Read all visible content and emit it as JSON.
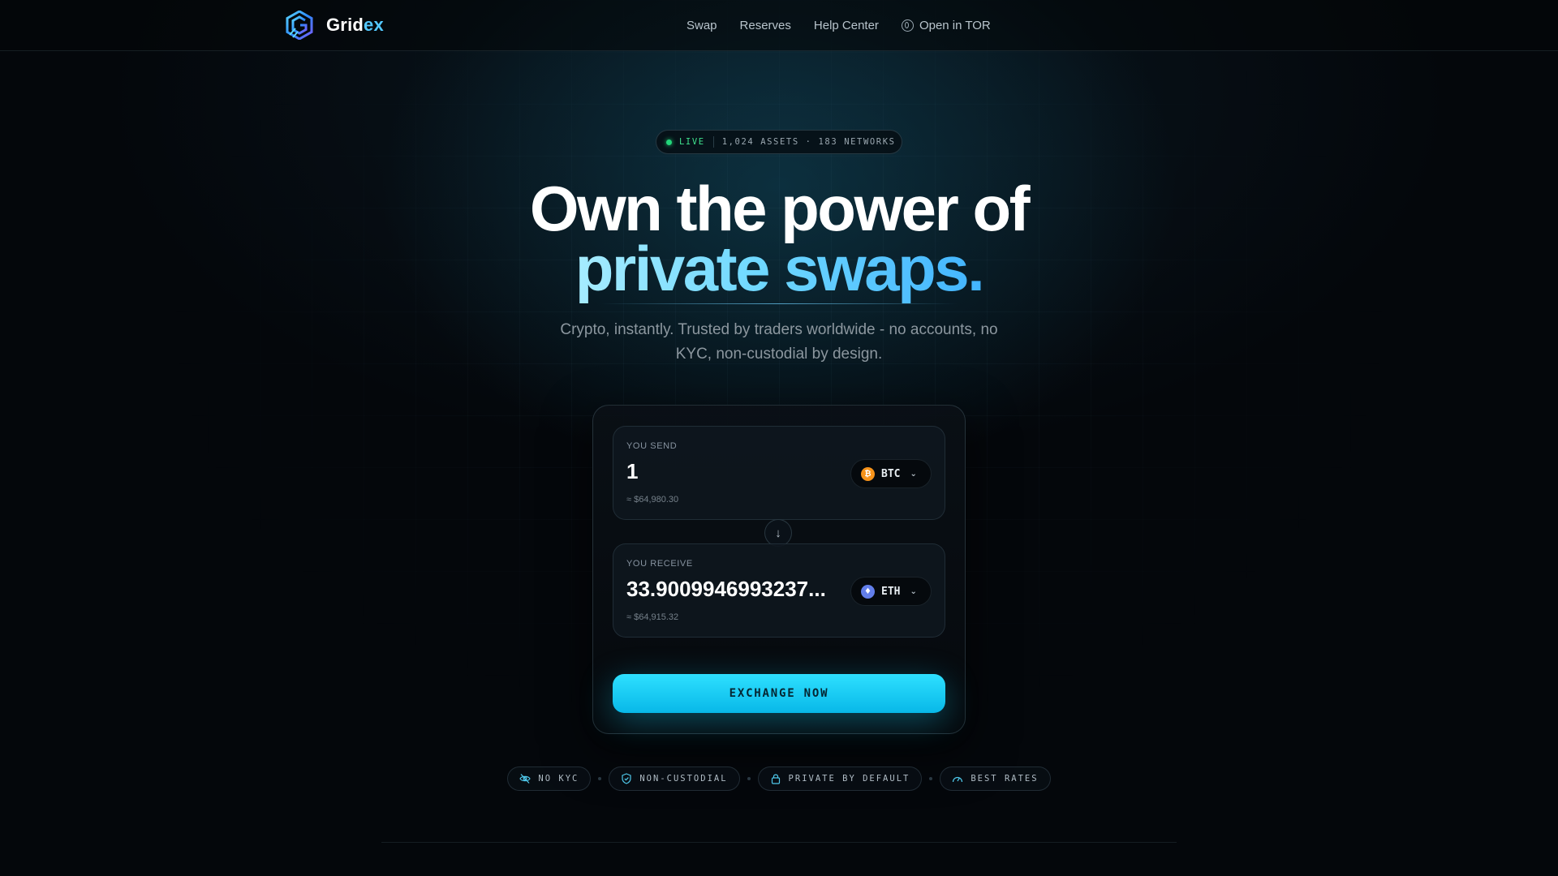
{
  "nav": {
    "brand_prefix": "Grid",
    "brand_suffix": "ex",
    "links": [
      "Swap",
      "Reserves",
      "Help Center",
      "Open in TOR"
    ]
  },
  "badge": {
    "status": "LIVE",
    "info": "1,024 ASSETS · 183 NETWORKS"
  },
  "hero": {
    "line1": "Own the power of",
    "line2": "private swaps.",
    "subtitle": "Crypto, instantly. Trusted by traders worldwide - no accounts, no KYC, non-custodial by design."
  },
  "swap": {
    "send": {
      "label": "YOU SEND",
      "amount": "1",
      "usd": "≈ $64,980.30",
      "coin": "BTC",
      "coin_icon": "bitcoin-icon"
    },
    "receive": {
      "label": "YOU RECEIVE",
      "amount": "33.9009946993237...",
      "usd": "≈ $64,915.32",
      "coin": "ETH",
      "coin_icon": "ethereum-icon"
    },
    "cta": "EXCHANGE NOW"
  },
  "features": [
    "NO KYC",
    "NON-CUSTODIAL",
    "PRIVATE BY DEFAULT",
    "BEST RATES"
  ],
  "colors": {
    "accent": "#2ee0ff",
    "live": "#22d67a",
    "btc": "#f7931a",
    "eth": "#627eea",
    "background": "#04070b"
  }
}
